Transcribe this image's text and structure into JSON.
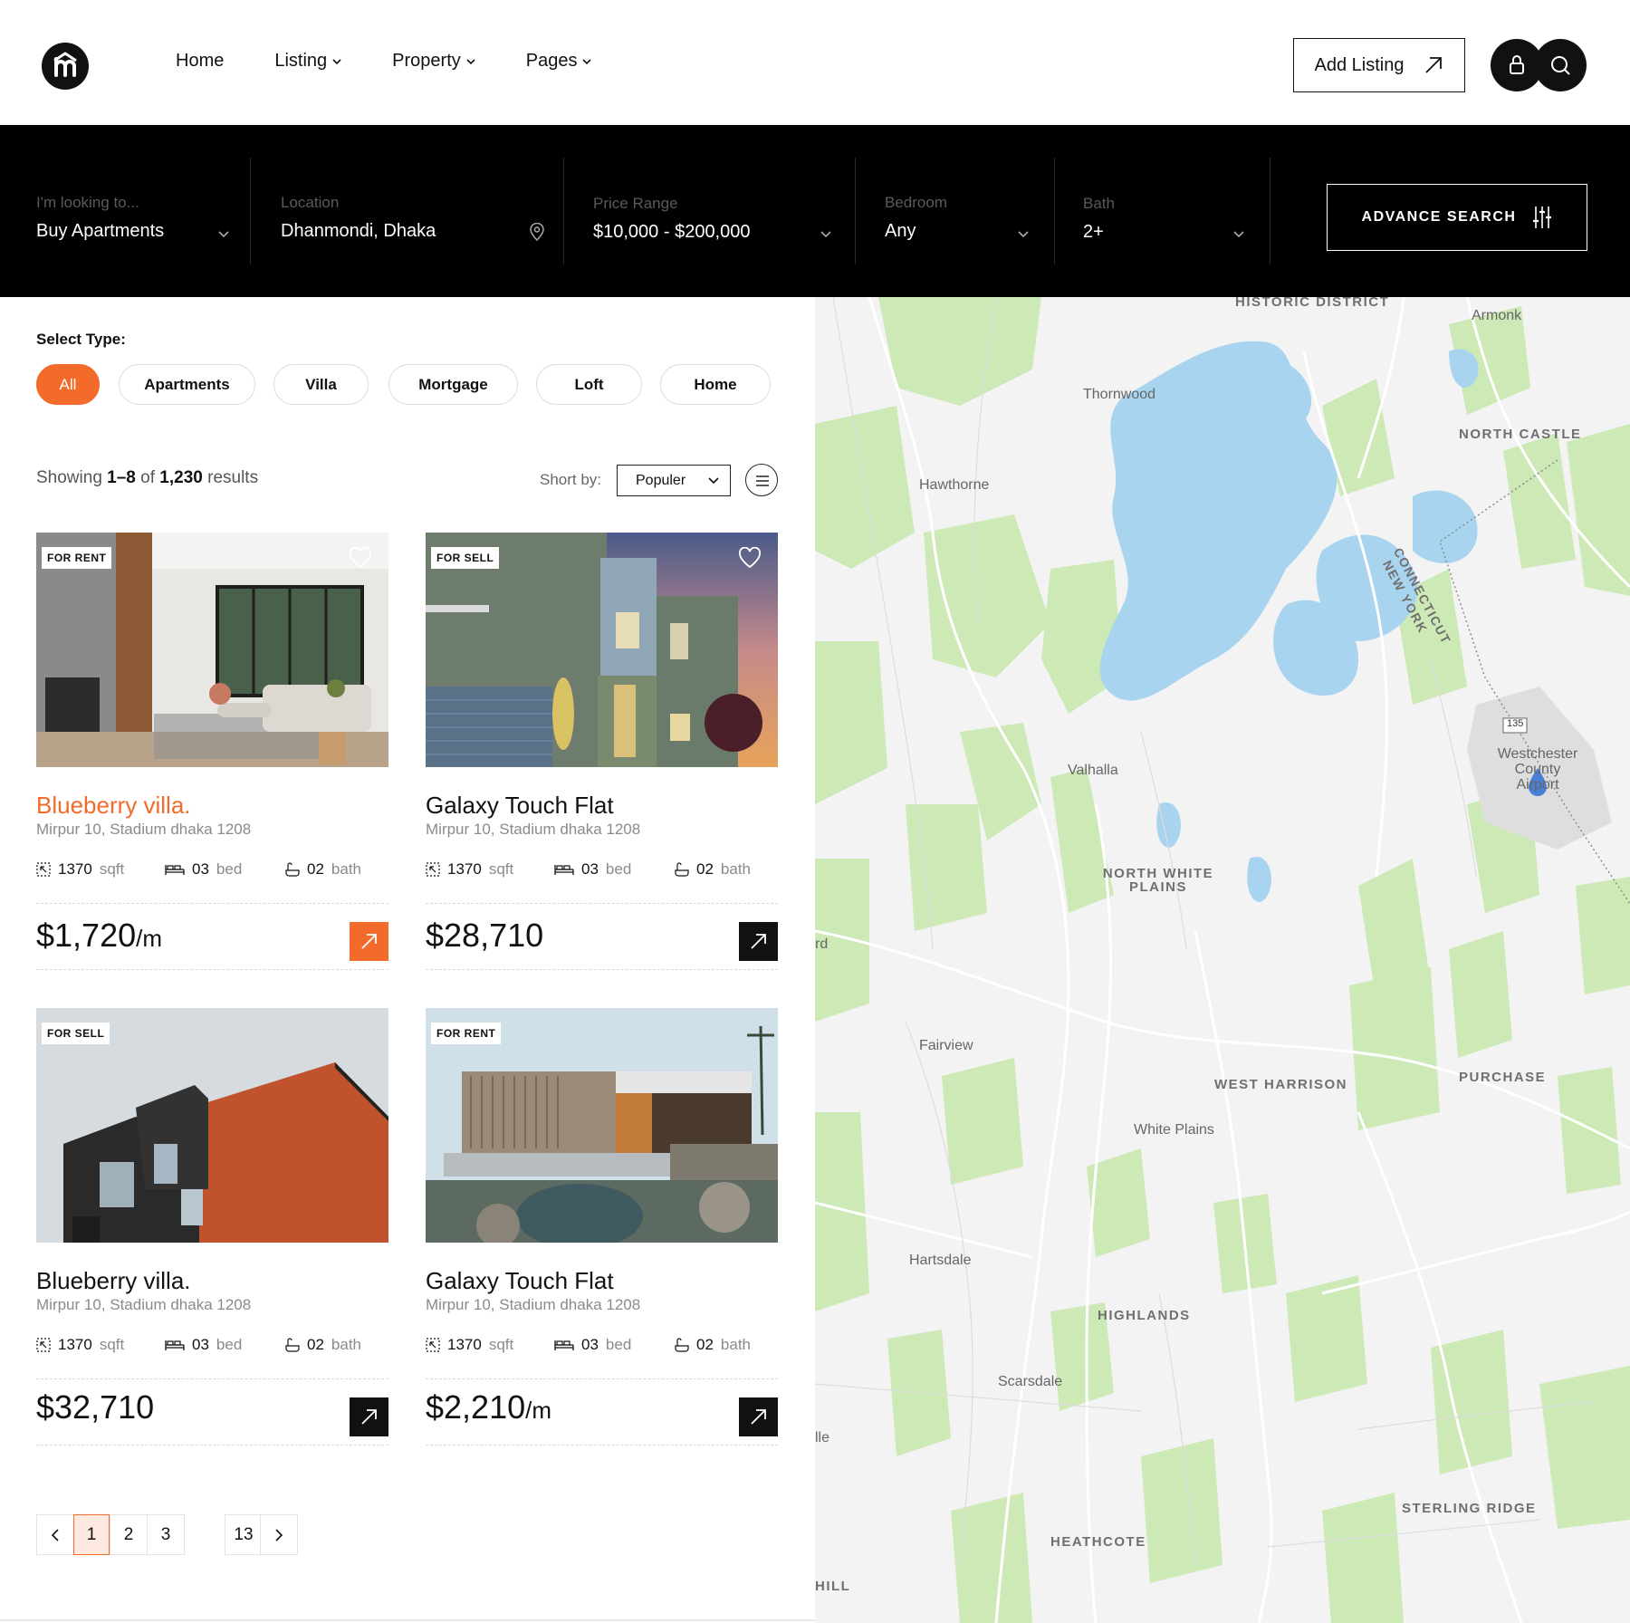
{
  "header": {
    "logo_icon": "home-logo-icon",
    "nav": [
      {
        "label": "Home",
        "has_dropdown": false
      },
      {
        "label": "Listing",
        "has_dropdown": true
      },
      {
        "label": "Property",
        "has_dropdown": true
      },
      {
        "label": "Pages",
        "has_dropdown": true
      }
    ],
    "add_listing_label": "Add Listing",
    "icons": [
      "lock-icon",
      "search-icon"
    ]
  },
  "search": {
    "looking": {
      "label": "I'm looking to...",
      "value": "Buy Apartments"
    },
    "location": {
      "label": "Location",
      "value": "Dhanmondi, Dhaka"
    },
    "price": {
      "label": "Price Range",
      "value": "$10,000 - $200,000"
    },
    "bedroom": {
      "label": "Bedroom",
      "value": "Any"
    },
    "bath": {
      "label": "Bath",
      "value": "2+"
    },
    "advance_label": "ADVANCE SEARCH"
  },
  "filters": {
    "label": "Select Type:",
    "types": [
      "All",
      "Apartments",
      "Villa",
      "Mortgage",
      "Loft",
      "Home"
    ],
    "active": "All"
  },
  "results": {
    "prefix": "Showing",
    "range": "1–8",
    "of": "of",
    "total": "1,230",
    "suffix": "results",
    "sort_label": "Short by:",
    "sort_value": "Populer"
  },
  "listings": [
    {
      "badge": "FOR RENT",
      "title": "Blueberry villa.",
      "address": "Mirpur 10, Stadium dhaka 1208",
      "sqft": "1370",
      "sqft_unit": "sqft",
      "bed": "03",
      "bed_unit": "bed",
      "bath": "02",
      "bath_unit": "bath",
      "price": "$1,720",
      "per": "/m",
      "favorite": true
    },
    {
      "badge": "FOR SELL",
      "title": "Galaxy Touch Flat",
      "address": "Mirpur 10, Stadium dhaka 1208",
      "sqft": "1370",
      "sqft_unit": "sqft",
      "bed": "03",
      "bed_unit": "bed",
      "bath": "02",
      "bath_unit": "bath",
      "price": "$28,710",
      "per": "",
      "favorite": true
    },
    {
      "badge": "FOR SELL",
      "title": "Blueberry villa.",
      "address": "Mirpur 10, Stadium dhaka 1208",
      "sqft": "1370",
      "sqft_unit": "sqft",
      "bed": "03",
      "bed_unit": "bed",
      "bath": "02",
      "bath_unit": "bath",
      "price": "$32,710",
      "per": "",
      "favorite": false
    },
    {
      "badge": "FOR RENT",
      "title": "Galaxy Touch Flat",
      "address": "Mirpur 10, Stadium dhaka 1208",
      "sqft": "1370",
      "sqft_unit": "sqft",
      "bed": "03",
      "bed_unit": "bed",
      "bath": "02",
      "bath_unit": "bath",
      "price": "$2,210",
      "per": "/m",
      "favorite": false
    }
  ],
  "pagination": {
    "pages": [
      "1",
      "2",
      "3",
      "13"
    ],
    "current": "1"
  },
  "map": {
    "labels": [
      "HISTORIC DISTRICT",
      "Armonk",
      "Thornwood",
      "NORTH CASTLE",
      "Hawthorne",
      "CONNECTICUT",
      "NEW YORK",
      "135",
      "Westchester County Airport",
      "Valhalla",
      "NORTH WHITE PLAINS",
      "rd",
      "Fairview",
      "WEST HARRISON",
      "PURCHASE",
      "White Plains",
      "Hartsdale",
      "HIGHLANDS",
      "Scarsdale",
      "lle",
      "STERLING RIDGE",
      "HEATHCOTE",
      "HILL"
    ]
  },
  "colors": {
    "accent": "#f26b2a",
    "dark": "#111111",
    "searchbar": "#000000",
    "water": "#a8d4f0",
    "park": "#cde9b6",
    "map_bg": "#f3f3f3"
  }
}
